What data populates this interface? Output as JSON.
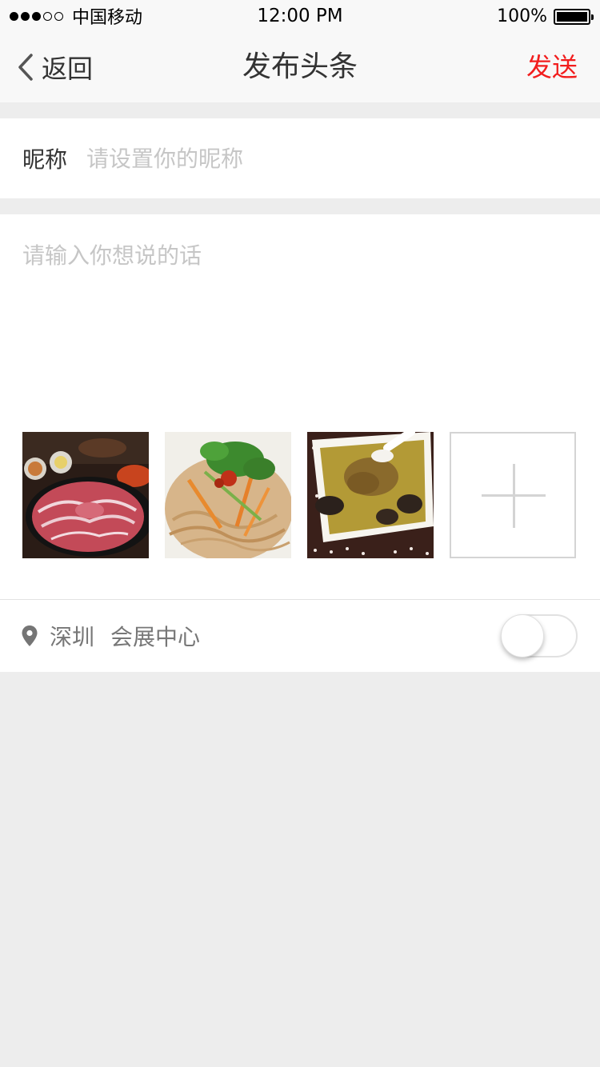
{
  "status_bar": {
    "carrier": "中国移动",
    "time": "12:00 PM",
    "battery": "100%",
    "signal_bars_filled": 3,
    "signal_bars_total": 5
  },
  "nav": {
    "back_label": "返回",
    "title": "发布头条",
    "send_label": "发送"
  },
  "nickname": {
    "label": "昵称",
    "placeholder": "请设置你的昵称",
    "value": ""
  },
  "content": {
    "placeholder": "请输入你想说的话",
    "value": ""
  },
  "photos": [
    {
      "name": "sliced-beef-hotpot-photo"
    },
    {
      "name": "cold-noodle-salad-photo"
    },
    {
      "name": "mushroom-chicken-soup-photo"
    }
  ],
  "location": {
    "city": "深圳",
    "place": "会展中心",
    "toggle_on": false
  },
  "colors": {
    "accent": "#f21d1d",
    "background": "#ededed",
    "placeholder": "#c6c6c6"
  },
  "icons": [
    "back-chevron-icon",
    "location-pin-icon",
    "plus-icon"
  ]
}
